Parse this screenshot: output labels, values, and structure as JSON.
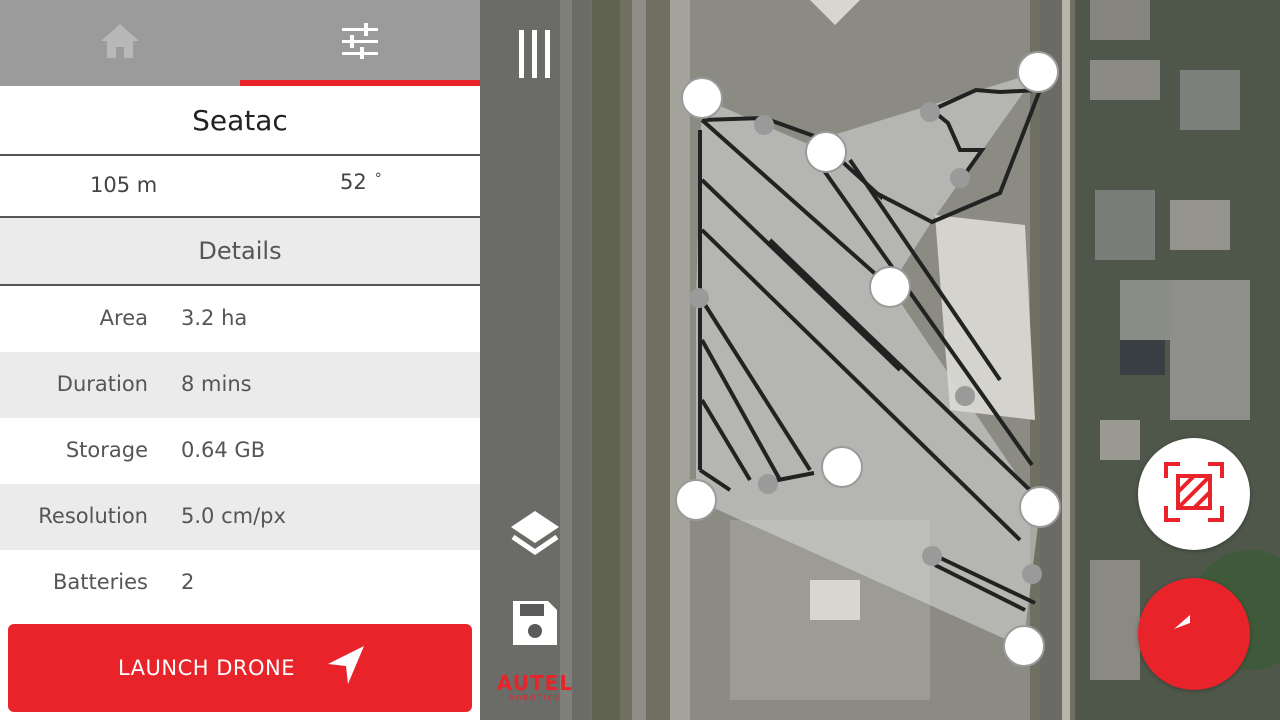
{
  "tabs": [
    {
      "name": "home",
      "icon": "home-icon",
      "selected": false
    },
    {
      "name": "settings",
      "icon": "sliders-icon",
      "selected": true
    }
  ],
  "mission": {
    "title": "Seatac",
    "distance": "105 m",
    "angle": "52",
    "angle_unit": "°"
  },
  "details": {
    "heading": "Details",
    "rows": [
      {
        "label": "Area",
        "value": "3.2 ha"
      },
      {
        "label": "Duration",
        "value": "8 mins"
      },
      {
        "label": "Storage",
        "value": "0.64 GB"
      },
      {
        "label": "Resolution",
        "value": "5.0 cm/px"
      },
      {
        "label": "Batteries",
        "value": "2"
      }
    ]
  },
  "launch": {
    "label": "LAUNCH DRONE",
    "icon": "navigation-arrow-icon"
  },
  "toolbar": {
    "menu_icon": "menu-icon",
    "layers_icon": "layers-icon",
    "save_icon": "save-icon"
  },
  "brand": {
    "name": "AUTEL",
    "sub": "ROBOTICS"
  },
  "map_controls": {
    "fit_icon": "fit-area-icon",
    "undo_icon": "undo-icon"
  },
  "colors": {
    "accent": "#e8232a",
    "tab_bar": "#9b9b9b",
    "row_shade": "#ebebeb",
    "polygon_fill": "#d0d0d0",
    "flight_line": "#222222"
  }
}
